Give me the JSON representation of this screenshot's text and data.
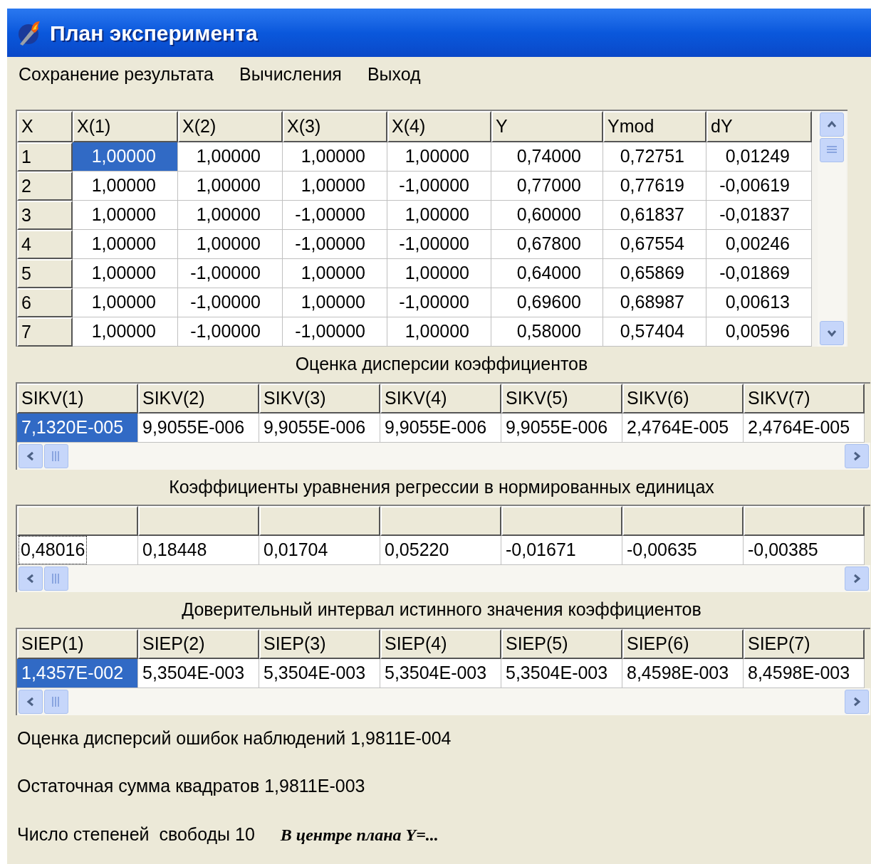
{
  "window": {
    "title": "План эксперимента"
  },
  "menu": [
    "Сохранение результата",
    "Вычисления",
    "Выход"
  ],
  "grids": [
    {
      "kind": "experiment_table",
      "row_header_column": "X",
      "columns": [
        "X(1)",
        "X(2)",
        "X(3)",
        "X(4)",
        "Y",
        "Ymod",
        "dY"
      ],
      "rows": [
        {
          "header": "1",
          "cells": [
            {
              "text": "1,00000",
              "selected": true
            },
            {
              "text": "1,00000",
              "selected": false
            },
            {
              "text": "1,00000",
              "selected": false
            },
            {
              "text": "1,00000",
              "selected": false
            },
            {
              "text": "0,74000",
              "selected": false
            },
            {
              "text": "0,72751",
              "selected": false
            },
            {
              "text": "0,01249",
              "selected": false
            }
          ]
        },
        {
          "header": "2",
          "cells": [
            {
              "text": "1,00000",
              "selected": false
            },
            {
              "text": "1,00000",
              "selected": false
            },
            {
              "text": "1,00000",
              "selected": false
            },
            {
              "text": "-1,00000",
              "selected": false
            },
            {
              "text": "0,77000",
              "selected": false
            },
            {
              "text": "0,77619",
              "selected": false
            },
            {
              "text": "-0,00619",
              "selected": false
            }
          ]
        },
        {
          "header": "3",
          "cells": [
            {
              "text": "1,00000",
              "selected": false
            },
            {
              "text": "1,00000",
              "selected": false
            },
            {
              "text": "-1,00000",
              "selected": false
            },
            {
              "text": "1,00000",
              "selected": false
            },
            {
              "text": "0,60000",
              "selected": false
            },
            {
              "text": "0,61837",
              "selected": false
            },
            {
              "text": "-0,01837",
              "selected": false
            }
          ]
        },
        {
          "header": "4",
          "cells": [
            {
              "text": "1,00000",
              "selected": false
            },
            {
              "text": "1,00000",
              "selected": false
            },
            {
              "text": "-1,00000",
              "selected": false
            },
            {
              "text": "-1,00000",
              "selected": false
            },
            {
              "text": "0,67800",
              "selected": false
            },
            {
              "text": "0,67554",
              "selected": false
            },
            {
              "text": "0,00246",
              "selected": false
            }
          ]
        },
        {
          "header": "5",
          "cells": [
            {
              "text": "1,00000",
              "selected": false
            },
            {
              "text": "-1,00000",
              "selected": false
            },
            {
              "text": "1,00000",
              "selected": false
            },
            {
              "text": "1,00000",
              "selected": false
            },
            {
              "text": "0,64000",
              "selected": false
            },
            {
              "text": "0,65869",
              "selected": false
            },
            {
              "text": "-0,01869",
              "selected": false
            }
          ]
        },
        {
          "header": "6",
          "cells": [
            {
              "text": "1,00000",
              "selected": false
            },
            {
              "text": "-1,00000",
              "selected": false
            },
            {
              "text": "1,00000",
              "selected": false
            },
            {
              "text": "-1,00000",
              "selected": false
            },
            {
              "text": "0,69600",
              "selected": false
            },
            {
              "text": "0,68987",
              "selected": false
            },
            {
              "text": "0,00613",
              "selected": false
            }
          ]
        },
        {
          "header": "7",
          "cells": [
            {
              "text": "1,00000",
              "selected": false
            },
            {
              "text": "-1,00000",
              "selected": false
            },
            {
              "text": "-1,00000",
              "selected": false
            },
            {
              "text": "1,00000",
              "selected": false
            },
            {
              "text": "0,58000",
              "selected": false
            },
            {
              "text": "0,57404",
              "selected": false
            },
            {
              "text": "0,00596",
              "selected": false
            }
          ]
        }
      ]
    },
    {
      "kind": "vector_table",
      "caption": "Оценка дисперсии коэффициентов",
      "columns": [
        "SIKV(1)",
        "SIKV(2)",
        "SIKV(3)",
        "SIKV(4)",
        "SIKV(5)",
        "SIKV(6)",
        "SIKV(7)"
      ],
      "rows": [
        {
          "cells": [
            {
              "text": "7,1320E-005",
              "selected": true
            },
            {
              "text": "9,9055E-006",
              "selected": false
            },
            {
              "text": "9,9055E-006",
              "selected": false
            },
            {
              "text": "9,9055E-006",
              "selected": false
            },
            {
              "text": "9,9055E-006",
              "selected": false
            },
            {
              "text": "2,4764E-005",
              "selected": false
            },
            {
              "text": "2,4764E-005",
              "selected": false
            }
          ]
        }
      ]
    },
    {
      "kind": "vector_table",
      "caption": "Коэффициенты уравнения регрессии в нормированных единицах",
      "rows": [
        {
          "cells": [
            {
              "text": "0,48016",
              "selected": false,
              "focused": true
            },
            {
              "text": "0,18448",
              "selected": false,
              "focused": false
            },
            {
              "text": "0,01704",
              "selected": false,
              "focused": false
            },
            {
              "text": "0,05220",
              "selected": false,
              "focused": false
            },
            {
              "text": "-0,01671",
              "selected": false,
              "focused": false
            },
            {
              "text": "-0,00635",
              "selected": false,
              "focused": false
            },
            {
              "text": "-0,00385",
              "selected": false,
              "focused": false
            }
          ]
        }
      ]
    },
    {
      "kind": "vector_table",
      "caption": "Доверительный интервал истинного значения коэффициентов",
      "columns": [
        "SIEP(1)",
        "SIEP(2)",
        "SIEP(3)",
        "SIEP(4)",
        "SIEP(5)",
        "SIEP(6)",
        "SIEP(7)"
      ],
      "rows": [
        {
          "cells": [
            {
              "text": "1,4357E-002",
              "selected": true
            },
            {
              "text": "5,3504E-003",
              "selected": false
            },
            {
              "text": "5,3504E-003",
              "selected": false
            },
            {
              "text": "5,3504E-003",
              "selected": false
            },
            {
              "text": "5,3504E-003",
              "selected": false
            },
            {
              "text": "8,4598E-003",
              "selected": false
            },
            {
              "text": "8,4598E-003",
              "selected": false
            }
          ]
        }
      ]
    }
  ],
  "summary": [
    "Оценка дисперсий ошибок наблюдений 1,9811E-004",
    "Остаточная сумма квадратов 1,9811E-003",
    "Число степеней  свободы 10"
  ],
  "note": "В центре плана Y=..."
}
